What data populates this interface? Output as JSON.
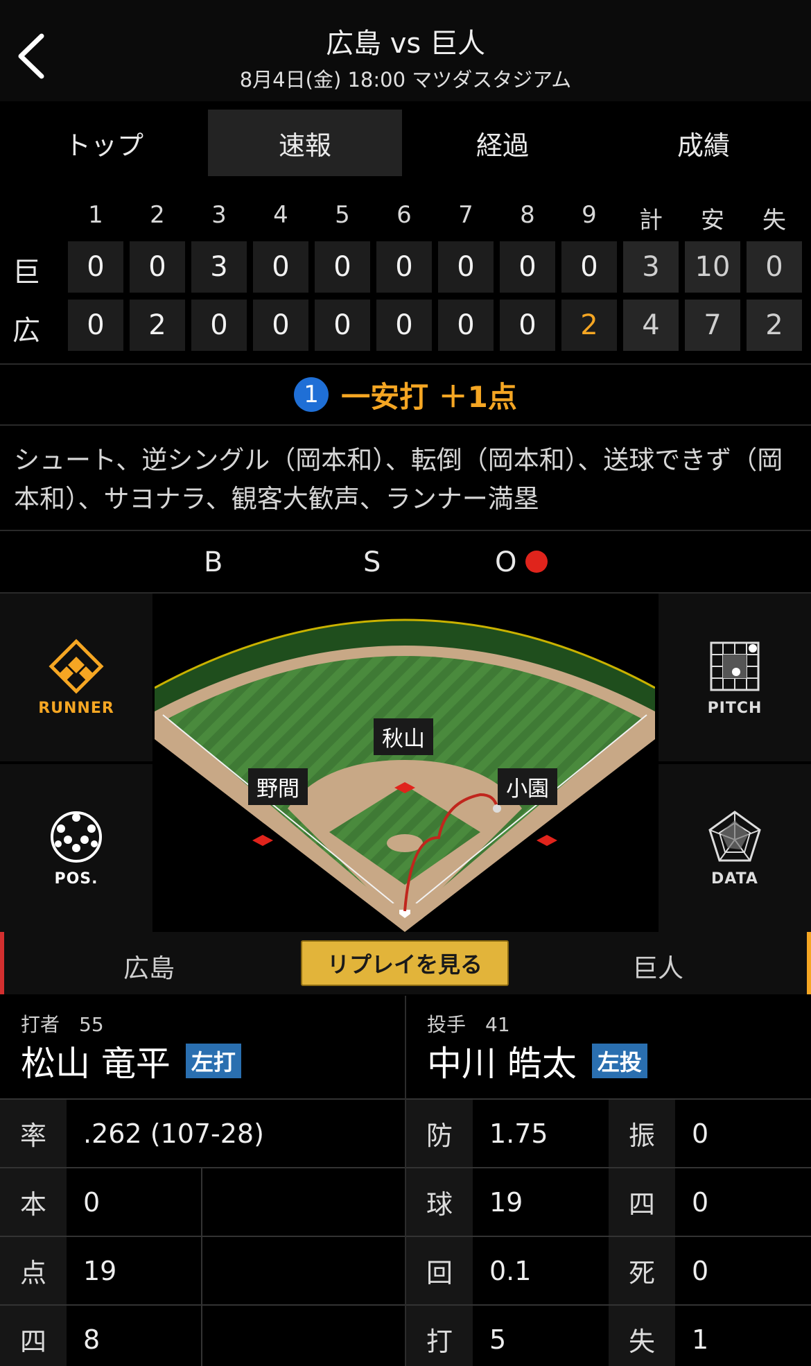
{
  "header": {
    "title": "広島 vs 巨人",
    "subtitle": "8月4日(金) 18:00 マツダスタジアム"
  },
  "tabs": [
    "トップ",
    "速報",
    "経過",
    "成績"
  ],
  "scoreboard": {
    "headers": [
      "1",
      "2",
      "3",
      "4",
      "5",
      "6",
      "7",
      "8",
      "9",
      "計",
      "安",
      "失"
    ],
    "rows": [
      {
        "team": "巨",
        "values": [
          "0",
          "0",
          "3",
          "0",
          "0",
          "0",
          "0",
          "0",
          "0",
          "3",
          "10",
          "0"
        ]
      },
      {
        "team": "広",
        "values": [
          "0",
          "2",
          "0",
          "0",
          "0",
          "0",
          "0",
          "0",
          "2",
          "4",
          "7",
          "2"
        ]
      }
    ]
  },
  "play": {
    "number": "1",
    "result": "一安打 ＋1点",
    "description": "シュート、逆シングル（岡本和）、転倒（岡本和）、送球できず（岡本和）、サヨナラ、観客大歓声、ランナー満塁"
  },
  "count": {
    "b": "B",
    "s": "S",
    "o": "O"
  },
  "side_buttons": {
    "runner": "RUNNER",
    "pitch": "PITCH",
    "pos": "POS.",
    "data": "DATA"
  },
  "fielders": {
    "center": "秋山",
    "left": "野間",
    "right": "小園"
  },
  "teambar": {
    "home": "広島",
    "replay": "リプレイを見る",
    "away": "巨人"
  },
  "batter": {
    "role": "打者　55",
    "name": "松山 竜平",
    "badge": "左打",
    "stats": [
      {
        "k": "率",
        "v": ".262 (107-28)"
      },
      {
        "k": "本",
        "v": "0"
      },
      {
        "k": "点",
        "v": "19"
      },
      {
        "k": "四",
        "v": "8"
      }
    ]
  },
  "pitcher": {
    "role": "投手　41",
    "name": "中川 皓太",
    "badge": "左投",
    "stats_left": [
      {
        "k": "防",
        "v": "1.75"
      },
      {
        "k": "球",
        "v": "19"
      },
      {
        "k": "回",
        "v": "0.1"
      },
      {
        "k": "打",
        "v": "5"
      }
    ],
    "stats_right": [
      {
        "k": "振",
        "v": "0"
      },
      {
        "k": "四",
        "v": "0"
      },
      {
        "k": "死",
        "v": "0"
      },
      {
        "k": "失",
        "v": "1"
      }
    ]
  },
  "colors": {
    "accent": "#f5a623",
    "out": "#e0241c",
    "badge": "#2a6fb0",
    "play_num": "#1f6fd6"
  }
}
